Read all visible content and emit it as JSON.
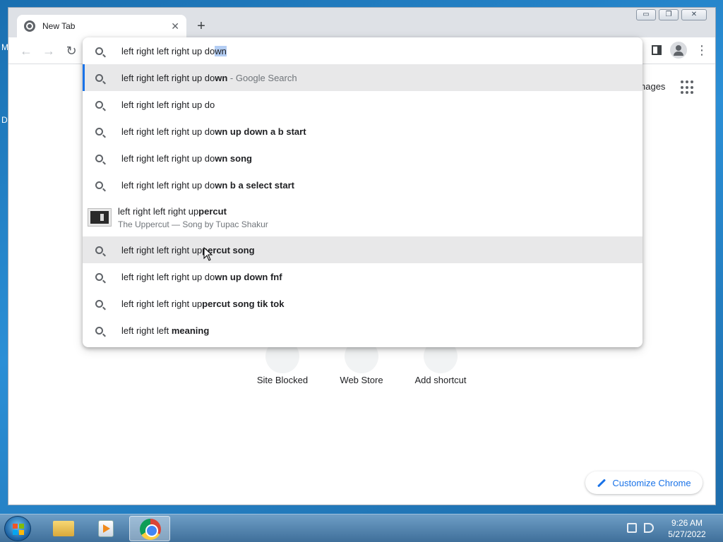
{
  "desktop": {
    "frag_top": "M",
    "frag_mid": "D"
  },
  "window": {
    "tab_title": "New Tab",
    "tab_close": "✕",
    "new_tab": "+",
    "controls": {
      "minimize": "▭",
      "restore": "❐",
      "close": "✕"
    }
  },
  "toolbar": {
    "back": "←",
    "forward": "→",
    "reload": "↻",
    "menu": "⋮"
  },
  "omnibox": {
    "typed": "left right left right up do",
    "autocomplete": "wn"
  },
  "suggestions": [
    {
      "plain": "left right left right up do",
      "bold": "wn",
      "dim": " - Google Search"
    },
    {
      "plain": "left right left right up do",
      "bold": "",
      "dim": ""
    },
    {
      "plain": "left right left right up do",
      "bold": "wn up down a b start",
      "dim": ""
    },
    {
      "plain": "left right left right up do",
      "bold": "wn song",
      "dim": ""
    },
    {
      "plain": "left right left right up do",
      "bold": "wn b a select start",
      "dim": ""
    },
    {
      "plain": "left right left right up",
      "bold": "percut",
      "subtitle": "The Uppercut — Song by Tupac Shakur"
    },
    {
      "plain": "left right left right up",
      "bold": "percut song",
      "dim": ""
    },
    {
      "plain": "left right left right up do",
      "bold": "wn up down fnf",
      "dim": ""
    },
    {
      "plain": "left right left right up",
      "bold": "percut song tik tok",
      "dim": ""
    },
    {
      "plain": "left right left ",
      "bold": "meaning",
      "dim": ""
    }
  ],
  "ntp": {
    "images_link": "nages",
    "shortcuts": [
      {
        "label": "Site Blocked"
      },
      {
        "label": "Web Store"
      },
      {
        "label": "Add shortcut"
      }
    ],
    "customize": "Customize Chrome"
  },
  "taskbar": {
    "time": "9:26 AM",
    "date": "5/27/2022"
  },
  "colors": {
    "accent": "#1a73e8",
    "selected_row": "#e8e8e9",
    "autocomplete_highlight": "#b3cdf3"
  }
}
